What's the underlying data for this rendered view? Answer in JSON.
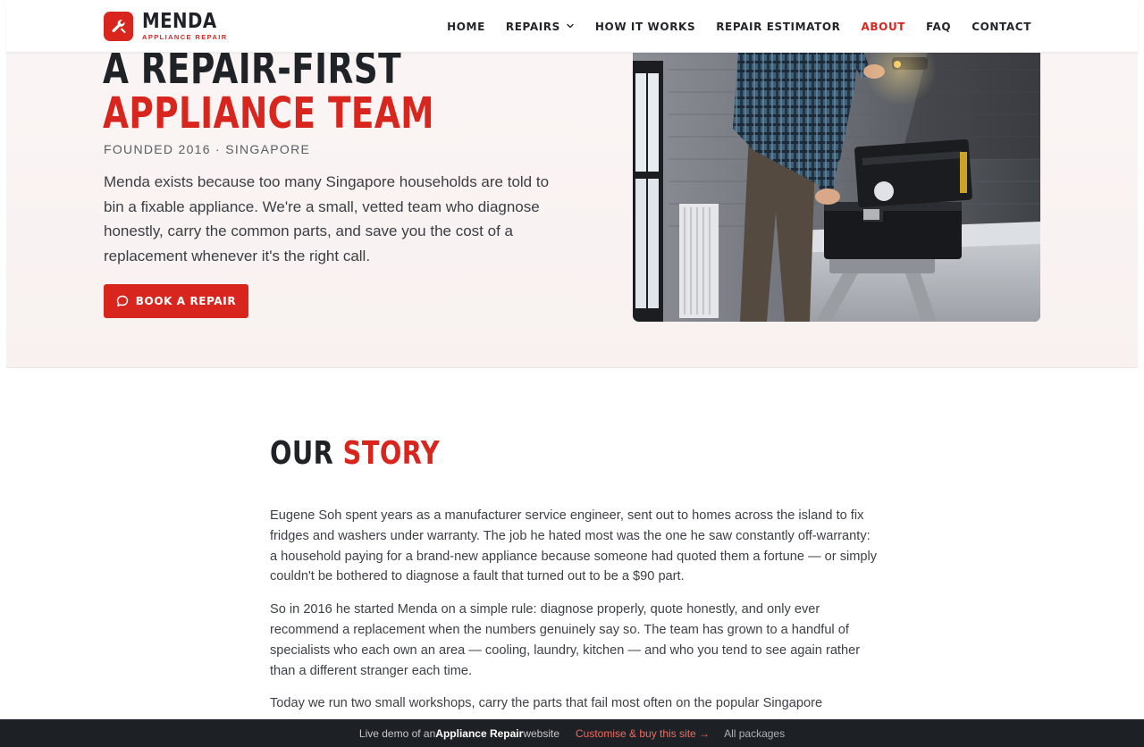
{
  "brand": {
    "name": "MENDA",
    "tagline": "APPLIANCE REPAIR",
    "accent_color": "#d8261f"
  },
  "nav": {
    "items": [
      {
        "label": "HOME",
        "active": false
      },
      {
        "label": "REPAIRS",
        "active": false,
        "dropdown": true
      },
      {
        "label": "HOW IT WORKS",
        "active": false
      },
      {
        "label": "REPAIR ESTIMATOR",
        "active": false
      },
      {
        "label": "ABOUT",
        "active": true
      },
      {
        "label": "FAQ",
        "active": false
      },
      {
        "label": "CONTACT",
        "active": false
      }
    ]
  },
  "hero": {
    "title_part1": "A REPAIR-FIRST ",
    "title_accent": "APPLIANCE TEAM",
    "meta": "FOUNDED 2016 · SINGAPORE",
    "text": "Menda exists because too many Singapore households are told to bin a fixable appliance. We're a small, vetted team who diagnose honestly, carry the common parts, and save you the cost of a replacement whenever it's the right call.",
    "cta_label": "BOOK A REPAIR"
  },
  "story": {
    "title_part1": "OUR ",
    "title_accent": "STORY",
    "paragraphs": [
      "Eugene Soh spent years as a manufacturer service engineer, sent out to homes across the island to fix fridges and washers under warranty. The job he hated most was the one he saw constantly off-warranty: a household paying for a brand-new appliance because someone had quoted them a fortune — or simply couldn't be bothered to diagnose a fault that turned out to be a $90 part.",
      "So in 2016 he started Menda on a simple rule: diagnose properly, quote honestly, and only ever recommend a replacement when the numbers genuinely say so. The team has grown to a handful of specialists who each own an area — cooling, laundry, kitchen — and who you tend to see again rather than a different stranger each time.",
      "Today we run two small workshops, carry the parts that fail most often on the popular Singapore"
    ]
  },
  "demo_bar": {
    "prefix": "Live demo of an ",
    "bold": "Appliance Repair",
    "suffix": " website",
    "link": "Customise & buy this site →",
    "packages": "All packages"
  }
}
